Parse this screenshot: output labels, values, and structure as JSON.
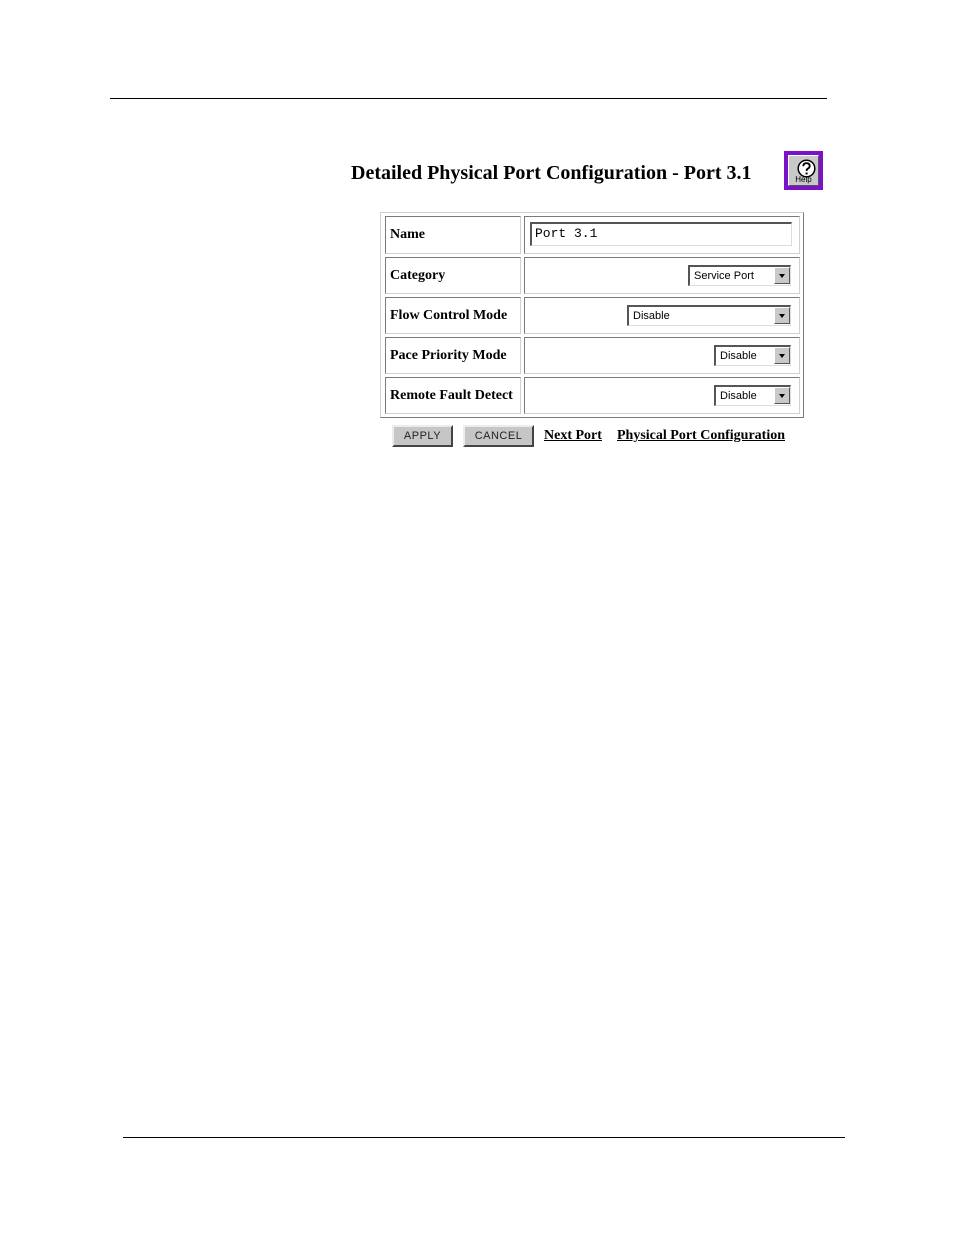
{
  "page": {
    "title": "Detailed Physical Port Configuration - Port 3.1"
  },
  "help": {
    "label": "Help",
    "icon": "question-mark-icon"
  },
  "form": {
    "name": {
      "label": "Name",
      "value": "Port 3.1"
    },
    "category": {
      "label": "Category",
      "value": "Service Port"
    },
    "flow_control_mode": {
      "label": "Flow Control Mode",
      "value": "Disable"
    },
    "pace_priority_mode": {
      "label": "Pace Priority Mode",
      "value": "Disable"
    },
    "remote_fault_detect": {
      "label": "Remote Fault Detect",
      "value": "Disable"
    }
  },
  "actions": {
    "apply_label": "APPLY",
    "cancel_label": "CANCEL",
    "next_port_label": "Next Port",
    "physical_port_config_label": "Physical Port Configuration"
  },
  "colors": {
    "help_border": "#7a12c8",
    "button_face": "#c6c6c6"
  }
}
